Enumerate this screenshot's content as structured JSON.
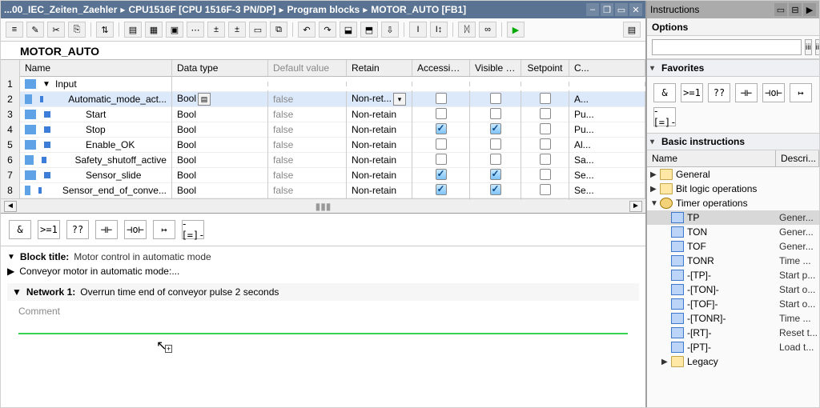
{
  "breadcrumb": [
    "...00_IEC_Zeiten_Zaehler",
    "CPU1516F [CPU 1516F-3 PN/DP]",
    "Program blocks",
    "MOTOR_AUTO [FB1]"
  ],
  "block_name": "MOTOR_AUTO",
  "var_table": {
    "headers": [
      "",
      "Name",
      "Data type",
      "Default value",
      "Retain",
      "Accessible f...",
      "Visible in ...",
      "Setpoint",
      "C..."
    ],
    "section": "Input",
    "rows": [
      {
        "n": 1,
        "section": true,
        "name": "Input"
      },
      {
        "n": 2,
        "name": "Automatic_mode_act...",
        "type": "Bool",
        "def": "false",
        "ret": "Non-ret...",
        "retDrop": true,
        "acc": false,
        "vis": false,
        "sp": false,
        "com": "A...",
        "hasTypeBtn": true,
        "selected": true
      },
      {
        "n": 3,
        "name": "Start",
        "type": "Bool",
        "def": "false",
        "ret": "Non-retain",
        "acc": false,
        "vis": false,
        "sp": false,
        "com": "Pu..."
      },
      {
        "n": 4,
        "name": "Stop",
        "type": "Bool",
        "def": "false",
        "ret": "Non-retain",
        "acc": true,
        "vis": true,
        "sp": false,
        "com": "Pu..."
      },
      {
        "n": 5,
        "name": "Enable_OK",
        "type": "Bool",
        "def": "false",
        "ret": "Non-retain",
        "acc": false,
        "vis": false,
        "sp": false,
        "com": "Al..."
      },
      {
        "n": 6,
        "name": "Safety_shutoff_active",
        "type": "Bool",
        "def": "false",
        "ret": "Non-retain",
        "acc": false,
        "vis": false,
        "sp": false,
        "com": "Sa..."
      },
      {
        "n": 7,
        "name": "Sensor_slide",
        "type": "Bool",
        "def": "false",
        "ret": "Non-retain",
        "acc": true,
        "vis": true,
        "sp": false,
        "com": "Se..."
      },
      {
        "n": 8,
        "name": "Sensor_end_of_conve...",
        "type": "Bool",
        "def": "false",
        "ret": "Non-retain",
        "acc": true,
        "vis": true,
        "sp": false,
        "com": "Se..."
      }
    ]
  },
  "palette_items": [
    "&",
    ">=1",
    "??",
    "⊣⊢",
    "⊣o⊢",
    "↦",
    "-[=]-"
  ],
  "block_title_label": "Block title:",
  "block_title_value": "Motor control in automatic mode",
  "conveyor_line": "Conveyor motor in automatic mode:...",
  "network_label": "Network 1:",
  "network_title": "Overrun time end of conveyor pulse 2 seconds",
  "comment_placeholder": "Comment",
  "side": {
    "title": "Instructions",
    "options": "Options",
    "favorites": "Favorites",
    "fav_items": [
      "&",
      ">=1",
      "??",
      "⊣⊢",
      "⊣o⊢",
      "↦",
      "-[=]-"
    ],
    "basic_title": "Basic instructions",
    "basic_headers": [
      "Name",
      "Descri..."
    ],
    "tree": [
      {
        "depth": 0,
        "tw": "▶",
        "ico": "folder",
        "name": "General",
        "desc": ""
      },
      {
        "depth": 0,
        "tw": "▶",
        "ico": "folder",
        "name": "Bit logic operations",
        "desc": ""
      },
      {
        "depth": 0,
        "tw": "▼",
        "ico": "timer",
        "name": "Timer operations",
        "desc": ""
      },
      {
        "depth": 1,
        "tw": "",
        "ico": "block",
        "name": "TP",
        "desc": "Gener...",
        "selected": true
      },
      {
        "depth": 1,
        "tw": "",
        "ico": "block",
        "name": "TON",
        "desc": "Gener..."
      },
      {
        "depth": 1,
        "tw": "",
        "ico": "block",
        "name": "TOF",
        "desc": "Gener..."
      },
      {
        "depth": 1,
        "tw": "",
        "ico": "block",
        "name": "TONR",
        "desc": "Time ..."
      },
      {
        "depth": 1,
        "tw": "",
        "ico": "block",
        "name": "-[TP]-",
        "desc": "Start p..."
      },
      {
        "depth": 1,
        "tw": "",
        "ico": "block",
        "name": "-[TON]-",
        "desc": "Start o..."
      },
      {
        "depth": 1,
        "tw": "",
        "ico": "block",
        "name": "-[TOF]-",
        "desc": "Start o..."
      },
      {
        "depth": 1,
        "tw": "",
        "ico": "block",
        "name": "-[TONR]-",
        "desc": "Time ..."
      },
      {
        "depth": 1,
        "tw": "",
        "ico": "block",
        "name": "-[RT]-",
        "desc": "Reset t..."
      },
      {
        "depth": 1,
        "tw": "",
        "ico": "block",
        "name": "-[PT]-",
        "desc": "Load t..."
      },
      {
        "depth": 1,
        "tw": "▶",
        "ico": "folder",
        "name": "Legacy",
        "desc": ""
      }
    ]
  }
}
